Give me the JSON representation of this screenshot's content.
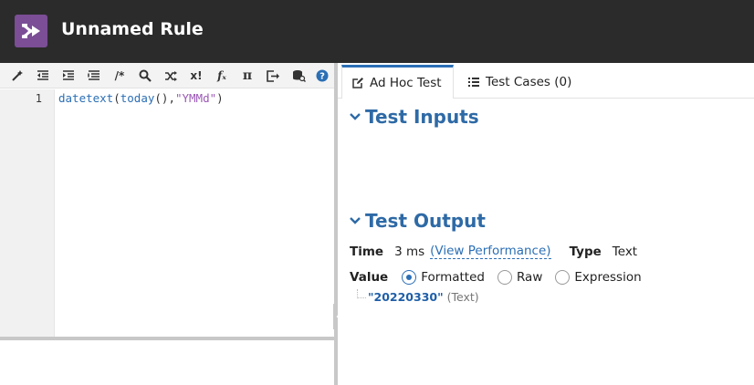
{
  "header": {
    "title": "Unnamed Rule",
    "logo_icon": "rule-arrow-icon",
    "accent": "#7b4e96"
  },
  "toolbar": {
    "buttons": [
      {
        "name": "magic-wand-icon"
      },
      {
        "name": "outdent-icon"
      },
      {
        "name": "indent-icon"
      },
      {
        "name": "format-lines-icon"
      },
      {
        "name": "comment-icon",
        "glyph": "/*"
      },
      {
        "name": "search-icon"
      },
      {
        "name": "shuffle-icon"
      },
      {
        "name": "variable-x-icon",
        "glyph": "x!"
      },
      {
        "name": "function-icon",
        "glyph": "fₓ"
      },
      {
        "name": "pi-icon",
        "glyph": "π"
      },
      {
        "name": "export-icon"
      },
      {
        "name": "database-search-icon"
      },
      {
        "name": "help-icon",
        "glyph": "?"
      }
    ]
  },
  "editor": {
    "line_number": "1",
    "code": {
      "fn1": "datetext",
      "p1": "(",
      "fn2": "today",
      "p2": "(),",
      "str": "\"YMMd\"",
      "p3": ")"
    }
  },
  "tabs": [
    {
      "label": "Ad Hoc Test",
      "icon": "edit-icon",
      "active": true
    },
    {
      "label": "Test Cases (0)",
      "icon": "list-icon",
      "active": false
    }
  ],
  "test_inputs": {
    "heading": "Test Inputs"
  },
  "test_output": {
    "heading": "Test Output",
    "time_label": "Time",
    "time_value": "3 ms",
    "view_perf": "(View Performance)",
    "type_label": "Type",
    "type_value": "Text",
    "value_label": "Value",
    "modes": [
      "Formatted",
      "Raw",
      "Expression"
    ],
    "selected_mode": "Formatted",
    "result_value": "\"20220330\"",
    "result_type": "(Text)"
  },
  "colors": {
    "link": "#2b6fb5",
    "heading": "#2e6aa6",
    "header_bg": "#2b2b2b"
  }
}
